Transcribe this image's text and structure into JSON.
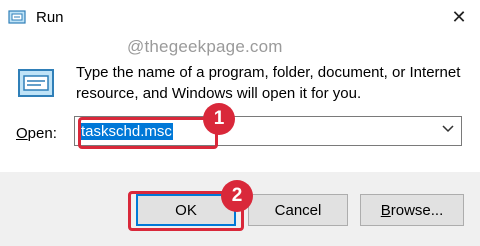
{
  "window": {
    "title": "Run",
    "close_glyph": "✕",
    "icon": "run-app-icon"
  },
  "watermark": "@thegeekpage.com",
  "description": "Type the name of a program, folder, document, or Internet resource, and Windows will open it for you.",
  "open": {
    "label_accel": "O",
    "label_rest": "pen:",
    "value": "taskschd.msc"
  },
  "annotations": {
    "step1": "1",
    "step2": "2",
    "color": "#d9283a"
  },
  "buttons": {
    "ok": "OK",
    "cancel": "Cancel",
    "browse_accel": "B",
    "browse_rest": "rowse..."
  },
  "colors": {
    "selection": "#0078d7",
    "footer": "#f0f0f0"
  }
}
